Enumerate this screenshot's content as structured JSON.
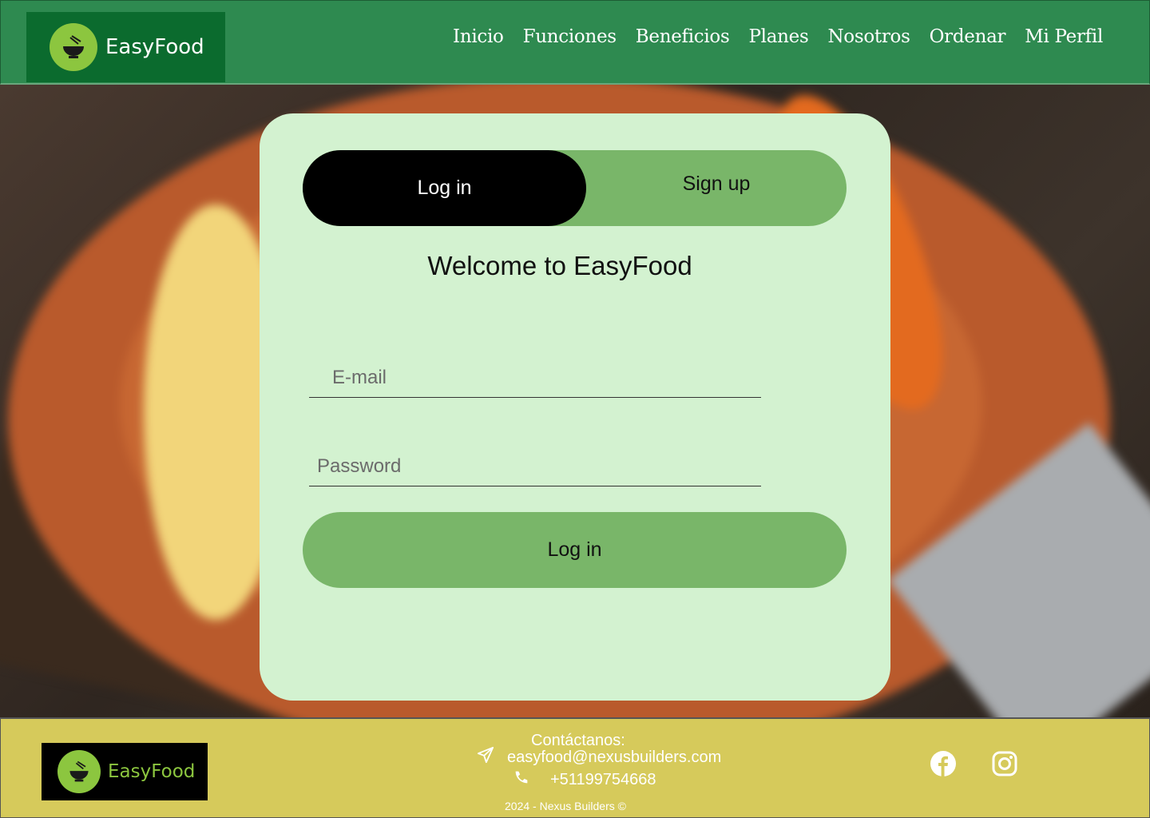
{
  "brand": {
    "name": "EasyFood"
  },
  "nav": {
    "items": [
      "Inicio",
      "Funciones",
      "Beneficios",
      "Planes",
      "Nosotros",
      "Ordenar",
      "Mi Perfil"
    ]
  },
  "auth": {
    "tabs": {
      "login": "Log in",
      "signup": "Sign up"
    },
    "active_tab": "login",
    "welcome": "Welcome to EasyFood",
    "email_placeholder": "E-mail",
    "password_placeholder": "Password",
    "submit_label": "Log in"
  },
  "footer": {
    "contact_title": "Contáctanos:",
    "email": "easyfood@nexusbuilders.com",
    "phone": "+51199754668",
    "copyright": "2024 - Nexus Builders ©"
  },
  "colors": {
    "header_bg": "#2e8a50",
    "card_bg": "#d3f2d0",
    "accent_green": "#79b669",
    "footer_bg": "#d6ca5b"
  },
  "icons": [
    "bowl-chopsticks-logo-icon",
    "send-icon",
    "phone-icon",
    "facebook-icon",
    "instagram-icon"
  ]
}
